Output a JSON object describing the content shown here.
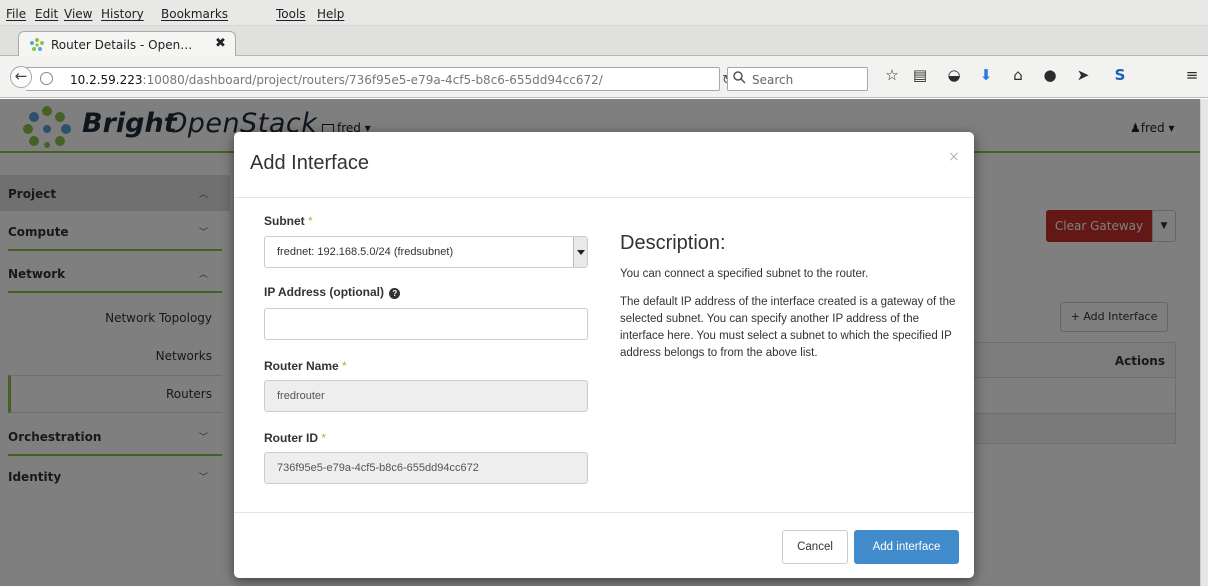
{
  "menubar": [
    "File",
    "Edit",
    "View",
    "History",
    "Bookmarks",
    "Tools",
    "Help"
  ],
  "tab": {
    "title": "Router Details - Open…",
    "close": "✖"
  },
  "navbar": {
    "url_host": "10.2.59.223",
    "url_rest": ":10080/dashboard/project/routers/736f95e5-e79a-4cf5-b8c6-655dd94cc672/",
    "search_placeholder": "Search"
  },
  "header": {
    "brand_bold": "Bright",
    "brand_light": "OpenStack",
    "project": "fred ▾",
    "user": "fred ▾"
  },
  "sidebar": {
    "project": "Project",
    "compute": "Compute",
    "network": "Network",
    "network_topology": "Network Topology",
    "networks": "Networks",
    "routers": "Routers",
    "orchestration": "Orchestration",
    "identity": "Identity"
  },
  "content": {
    "clear_gateway": "Clear Gateway",
    "add_interface": "Add Interface",
    "actions_header": "Actions"
  },
  "modal": {
    "title": "Add Interface",
    "close": "×",
    "subnet_label": "Subnet",
    "subnet_value": "frednet: 192.168.5.0/24 (fredsubnet)",
    "ip_label": "IP Address (optional)",
    "ip_value": "",
    "router_name_label": "Router Name",
    "router_name_value": "fredrouter",
    "router_id_label": "Router ID",
    "router_id_value": "736f95e5-e79a-4cf5-b8c6-655dd94cc672",
    "required_mark": "*",
    "desc_title": "Description:",
    "desc_p1": "You can connect a specified subnet to the router.",
    "desc_p2": "The default IP address of the interface created is a gateway of the selected subnet. You can specify another IP address of the interface here. You must select a subnet to which the specified IP address belongs to from the above list.",
    "cancel": "Cancel",
    "submit": "Add interface"
  },
  "colors": {
    "accent_green": "#8bc34a",
    "danger": "#c9302c",
    "primary": "#428bca"
  }
}
